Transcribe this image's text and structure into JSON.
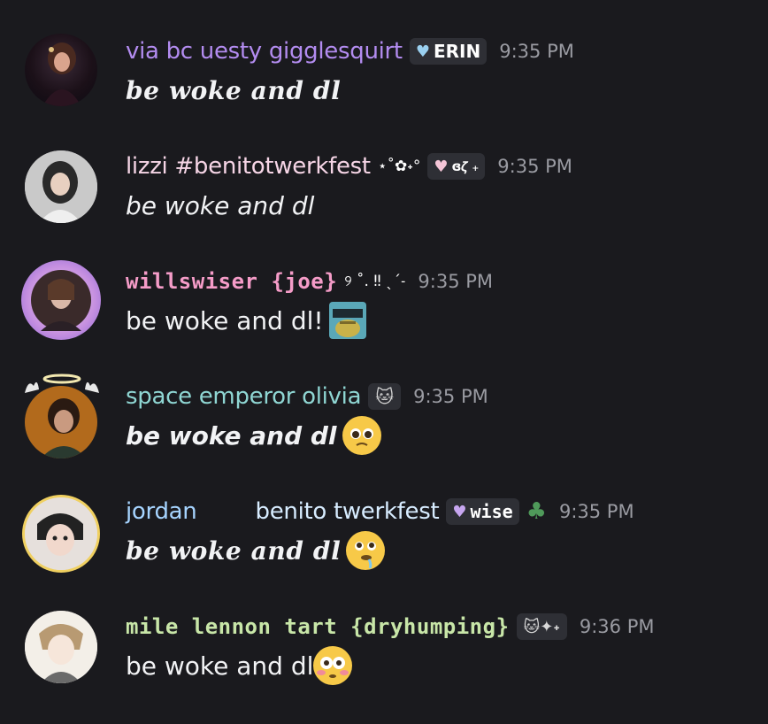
{
  "messages": [
    {
      "username": "via bc uesty gigglesquirt",
      "username_color": "#b38cf0",
      "tag_icon": "heart-icon",
      "tag_text": "ERIN",
      "time": "9:35 PM",
      "text": "be woke and dl"
    },
    {
      "username": "lizzi #benitotwerkfest",
      "username_color": "#f6d5e6",
      "decoration": "⋆˚✿˖°",
      "tag_icon": "heart-icon",
      "tag_text": "ɞ𝜁 ₊",
      "time": "9:35 PM",
      "text": "be woke and dl"
    },
    {
      "username": "willswiser {joe}",
      "username_color": "#f59cc8",
      "decoration": "୨ ˚. ‼︎ ˎˊ˗",
      "time": "9:35 PM",
      "text": "be woke and dl!",
      "sticker": "cool-frog-sticker"
    },
    {
      "username": "space emperor olivia",
      "username_color": "#8fd6d3",
      "tag_icon": "cat-icon",
      "time": "9:35 PM",
      "text": "be woke and dl",
      "emoji": "pleading-face-emoji"
    },
    {
      "username": "jordan",
      "username_color": "#a6d4ff",
      "username_extra": "benito twerkfest",
      "tag_icon": "heart-icon",
      "tag_text": "wise",
      "time": "9:35 PM",
      "text": "be woke and dl",
      "emoji": "drooling-face-emoji"
    },
    {
      "username": "mile lennon tart {dryhumping}",
      "username_color": "#c8e6a8",
      "tag_icon": "cat-sparkles-icon",
      "time": "9:36 PM",
      "text": "be woke and dl",
      "emoji": "flushed-face-emoji"
    }
  ]
}
